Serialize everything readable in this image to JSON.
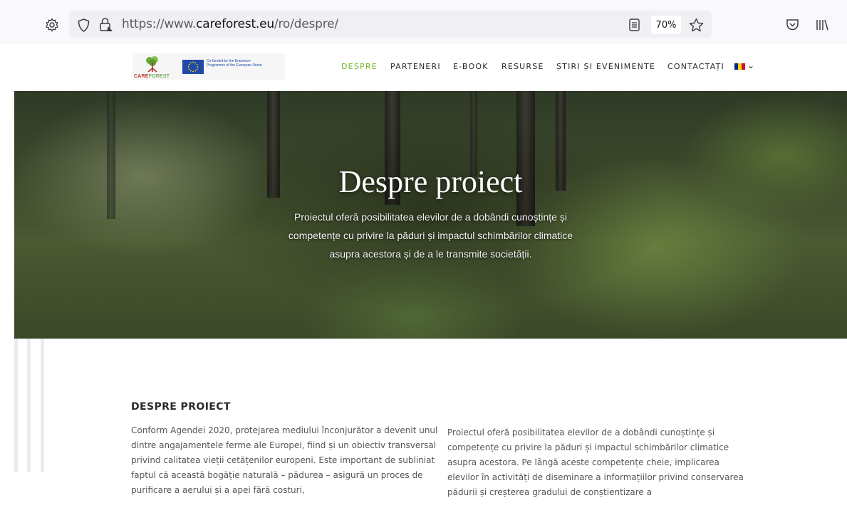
{
  "browser": {
    "url_prefix": "https://www.",
    "url_domain": "careforest.eu",
    "url_path": "/ro/despre/",
    "zoom": "70%"
  },
  "header": {
    "logo_text_care": "CARE",
    "logo_text_forest": "FOREST",
    "eu_text": "Co-funded by the Erasmus+ Programme of the European Union",
    "nav": [
      {
        "label": "DESPRE",
        "active": true
      },
      {
        "label": "PARTENERI",
        "active": false
      },
      {
        "label": "E-BOOK",
        "active": false
      },
      {
        "label": "RESURSE",
        "active": false
      },
      {
        "label": "ȘTIRI ȘI EVENIMENTE",
        "active": false
      },
      {
        "label": "CONTACTAȚI",
        "active": false
      }
    ],
    "lang_chevron": "⌄"
  },
  "hero": {
    "title": "Despre proiect",
    "subtitle": "Proiectul oferă posibilitatea elevilor de a dobândi cunoștințe și competențe cu privire la păduri și impactul schimbărilor climatice asupra acestora și de a le transmite societății."
  },
  "content": {
    "section_title": "DESPRE PROIECT",
    "col_left": "Conform Agendei 2020, protejarea mediului înconjurător a devenit unul dintre angajamentele ferme ale Europei, fiind și un obiectiv transversal privind calitatea vieții cetățenilor europeni. Este important de subliniat faptul că această bogăție naturală – pădurea – asigură un proces de purificare a aerului și a apei fără costuri,",
    "col_right": "Proiectul oferă posibilitatea elevilor de a dobândi cunoștințe și competențe cu privire la păduri și impactul schimbărilor climatice asupra acestora. Pe lângă aceste competențe cheie, implicarea elevilor în activități de diseminare a informațiilor privind conservarea pădurii și creșterea gradului de conștientizare a"
  },
  "colors": {
    "nav_active": "#77b82b",
    "browser_bg": "#f9f9fb",
    "text": "#555555"
  },
  "icons": [
    "gear-icon",
    "shield-icon",
    "lock-icon",
    "reader-view-icon",
    "bookmark-star-icon",
    "pocket-icon",
    "library-icon",
    "chevron-down-icon"
  ]
}
